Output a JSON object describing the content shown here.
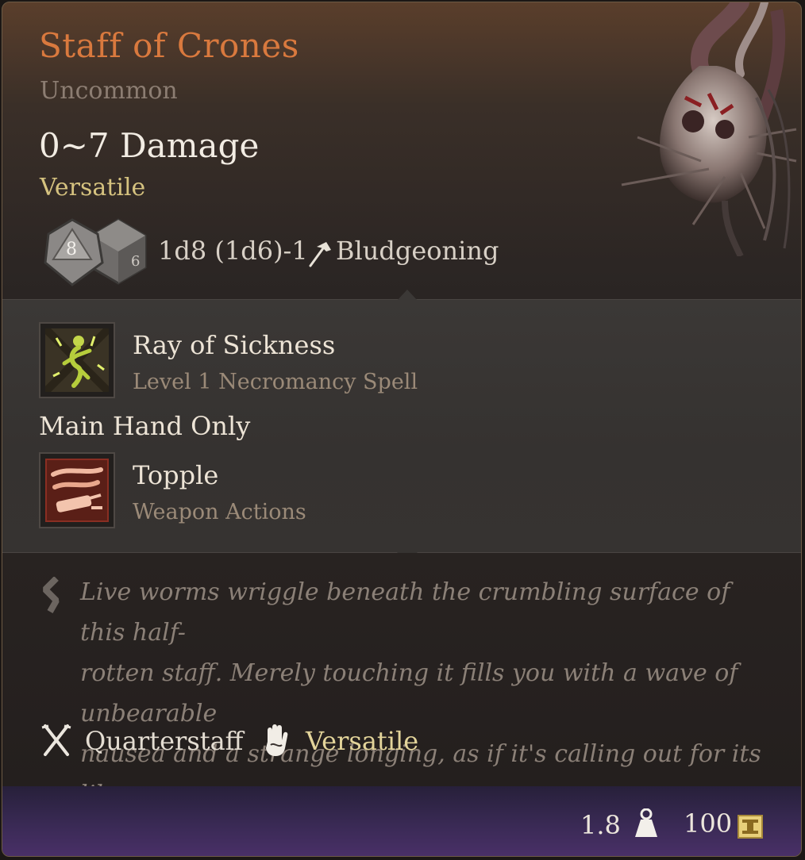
{
  "item": {
    "name": "Staff of Crones",
    "rarity": "Uncommon",
    "damage": "0~7 Damage",
    "property": "Versatile",
    "dice_faces": [
      "8",
      "6"
    ],
    "damage_formula": "1d8 (1d6)-1",
    "damage_type": "Bludgeoning"
  },
  "actions": {
    "ray": {
      "name": "Ray of Sickness",
      "sub": "Level 1 Necromancy Spell",
      "icon": "ray-of-sickness-icon"
    },
    "restriction": "Main Hand Only",
    "topple": {
      "name": "Topple",
      "sub": "Weapon Actions",
      "icon": "topple-icon"
    }
  },
  "flavor": {
    "line1": "Live worms wriggle beneath the crumbling surface of this half-",
    "line2": "rotten staff. Merely touching it fills you with a wave of unbearable",
    "line3": "nausea and a strange longing, as if it's calling out for its like."
  },
  "properties": [
    {
      "label": "Quarterstaff",
      "icon": "crossed-weapons-icon"
    },
    {
      "label": "Versatile",
      "icon": "hand-icon"
    }
  ],
  "footer": {
    "weight": "1.8",
    "value": "100"
  },
  "colors": {
    "title": "#d9793e",
    "rarity": "#8c7d72",
    "property": "#d5c27f",
    "flavor": "#8b8077",
    "footer": "#3a2a55"
  }
}
